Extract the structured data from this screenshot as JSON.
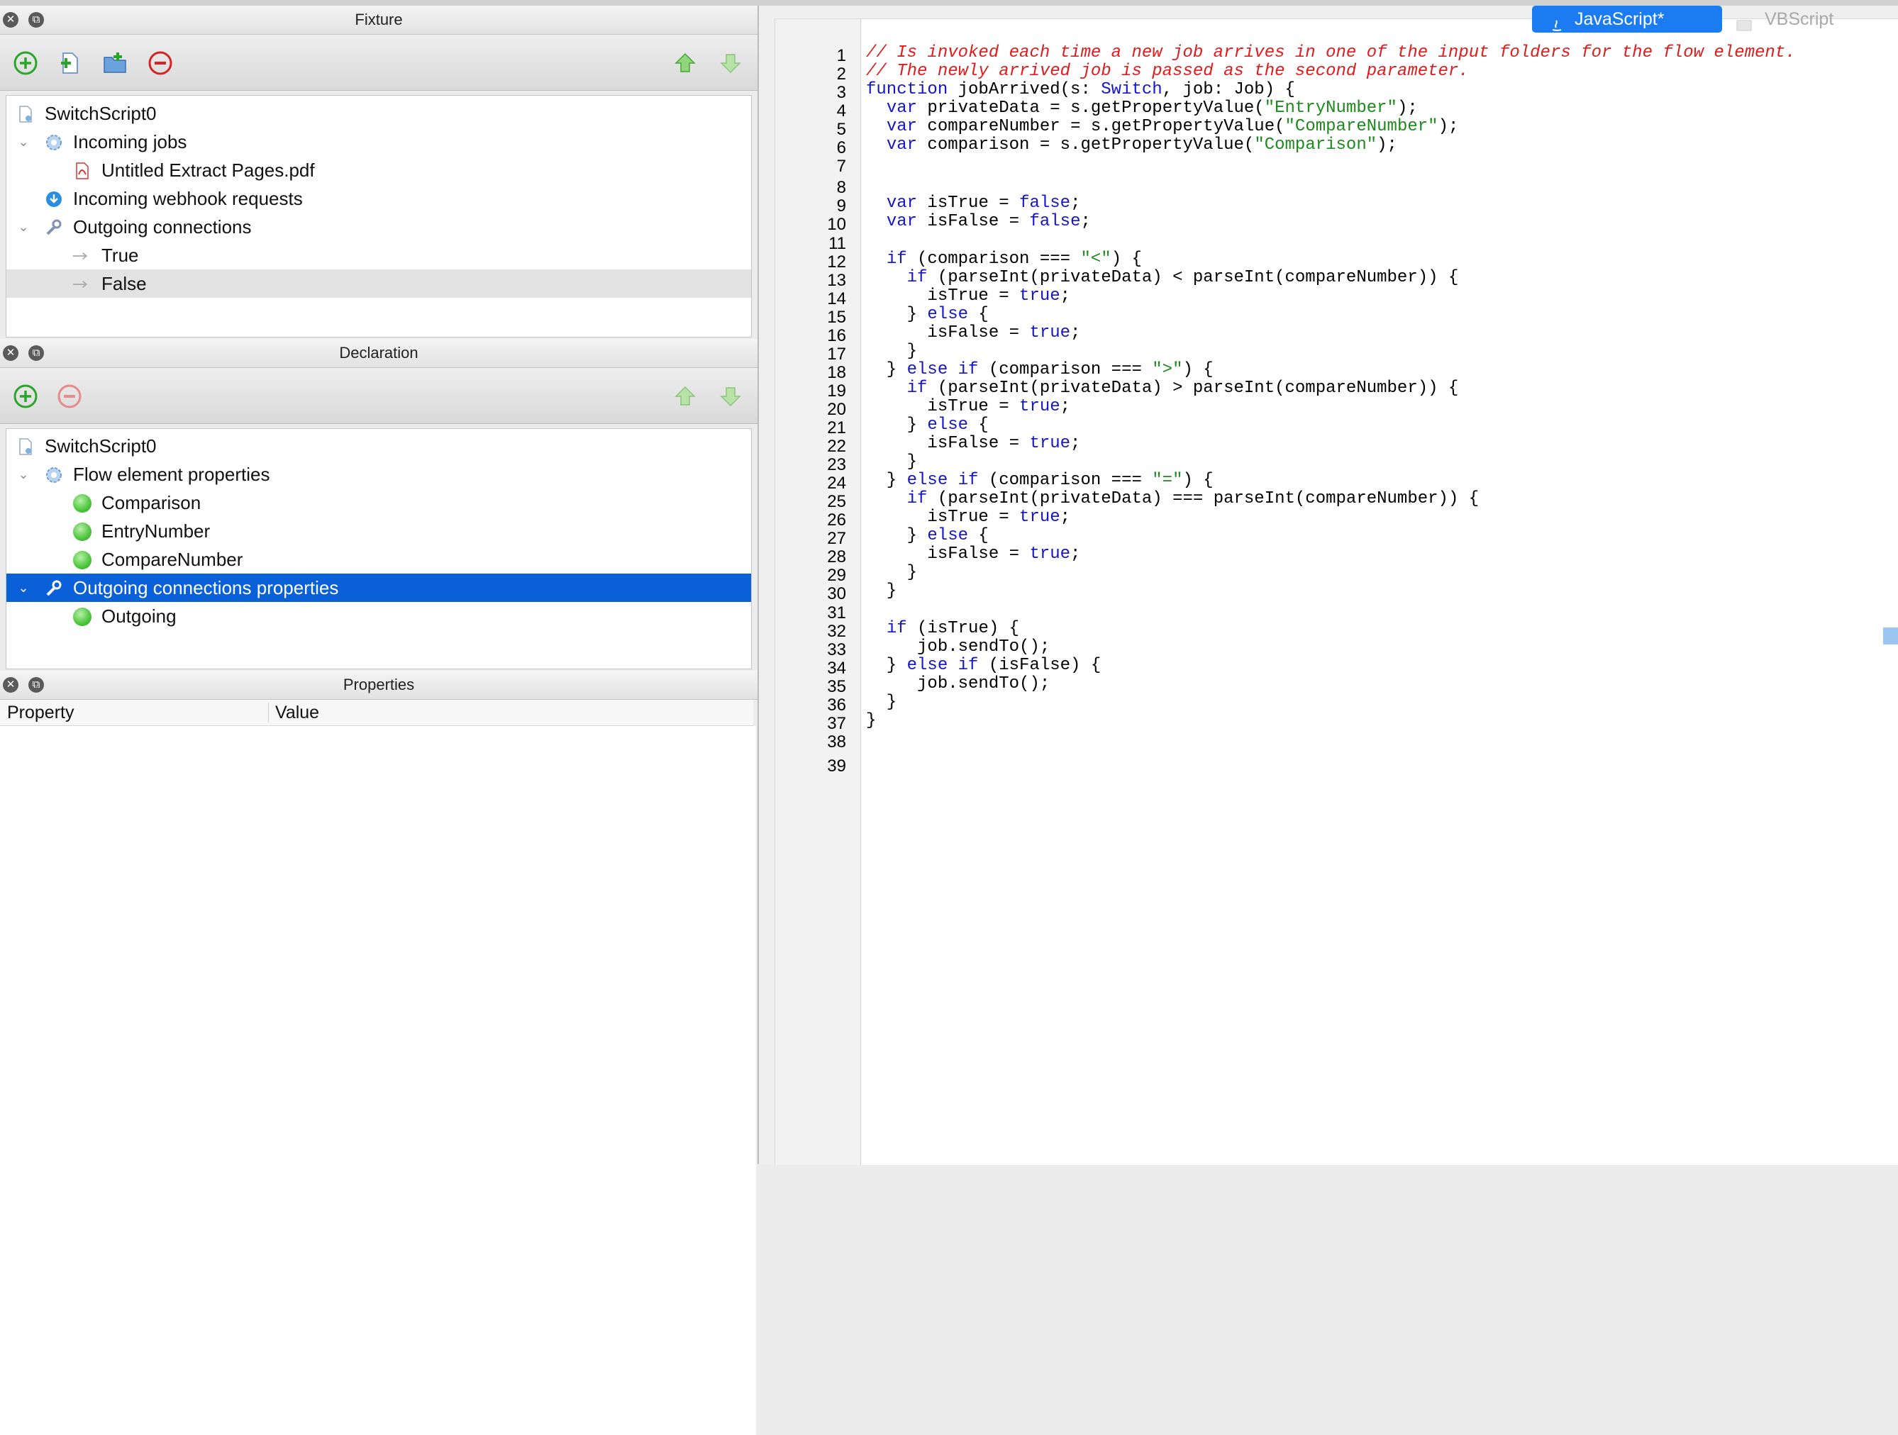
{
  "fixture": {
    "title": "Fixture",
    "items": [
      {
        "label": "SwitchScript0",
        "icon": "script-file-icon",
        "chev": ""
      },
      {
        "label": "Incoming jobs",
        "icon": "gear-icon",
        "chev": "⌄"
      },
      {
        "label": "Untitled Extract Pages.pdf",
        "icon": "pdf-file-icon",
        "chev": ""
      },
      {
        "label": "Incoming webhook requests",
        "icon": "webhook-download-icon",
        "chev": ""
      },
      {
        "label": "Outgoing connections",
        "icon": "wrench-icon",
        "chev": "⌄"
      },
      {
        "label": "True",
        "icon": "connection-arrow-icon",
        "chev": ""
      },
      {
        "label": "False",
        "icon": "connection-arrow-icon",
        "chev": ""
      }
    ]
  },
  "declaration": {
    "title": "Declaration",
    "items": [
      {
        "label": "SwitchScript0",
        "icon": "script-file-icon",
        "chev": ""
      },
      {
        "label": "Flow element properties",
        "icon": "gear-icon",
        "chev": "⌄"
      },
      {
        "label": "Comparison",
        "icon": "green-dot-icon",
        "chev": ""
      },
      {
        "label": "EntryNumber",
        "icon": "green-dot-icon",
        "chev": ""
      },
      {
        "label": "CompareNumber",
        "icon": "green-dot-icon",
        "chev": ""
      },
      {
        "label": "Outgoing connections properties",
        "icon": "wrench-icon",
        "chev": "⌄"
      },
      {
        "label": "Outgoing",
        "icon": "green-dot-icon",
        "chev": ""
      }
    ]
  },
  "properties": {
    "title": "Properties",
    "col_property": "Property",
    "col_value": "Value"
  },
  "tabs": {
    "javascript": "JavaScript*",
    "vbscript": "VBScript"
  },
  "editor": {
    "line_numbers": [
      "1",
      "2",
      "3",
      "4",
      "5",
      "6",
      "7",
      "8",
      "9",
      "10",
      "11",
      "12",
      "13",
      "14",
      "15",
      "16",
      "17",
      "18",
      "19",
      "20",
      "21",
      "22",
      "23",
      "24",
      "25",
      "26",
      "27",
      "28",
      "29",
      "30",
      "31",
      "32",
      "33",
      "34",
      "35",
      "36",
      "37",
      "38",
      "39"
    ],
    "lines": [
      "// Is invoked each time a new job arrives in one of the input folders for the flow element.",
      "// The newly arrived job is passed as the second parameter.",
      "function jobArrived(s: Switch, job: Job) {",
      "  var privateData = s.getPropertyValue(\"EntryNumber\");",
      "  var compareNumber = s.getPropertyValue(\"CompareNumber\");",
      "  var comparison = s.getPropertyValue(\"Comparison\");",
      "",
      "",
      "  var isTrue = false;",
      "  var isFalse = false;",
      "",
      "  if (comparison === \"<\") {",
      "    if (parseInt(privateData) < parseInt(compareNumber)) {",
      "      isTrue = true;",
      "    } else {",
      "      isFalse = true;",
      "    }",
      "  } else if (comparison === \">\") {",
      "    if (parseInt(privateData) > parseInt(compareNumber)) {",
      "      isTrue = true;",
      "    } else {",
      "      isFalse = true;",
      "    }",
      "  } else if (comparison === \"=\") {",
      "    if (parseInt(privateData) === parseInt(compareNumber)) {",
      "      isTrue = true;",
      "    } else {",
      "      isFalse = true;",
      "    }",
      "  }",
      "",
      "  if (isTrue) {",
      "     job.sendTo();",
      "  } else if (isFalse) {",
      "     job.sendTo();",
      "  }",
      "}",
      "",
      ""
    ]
  }
}
